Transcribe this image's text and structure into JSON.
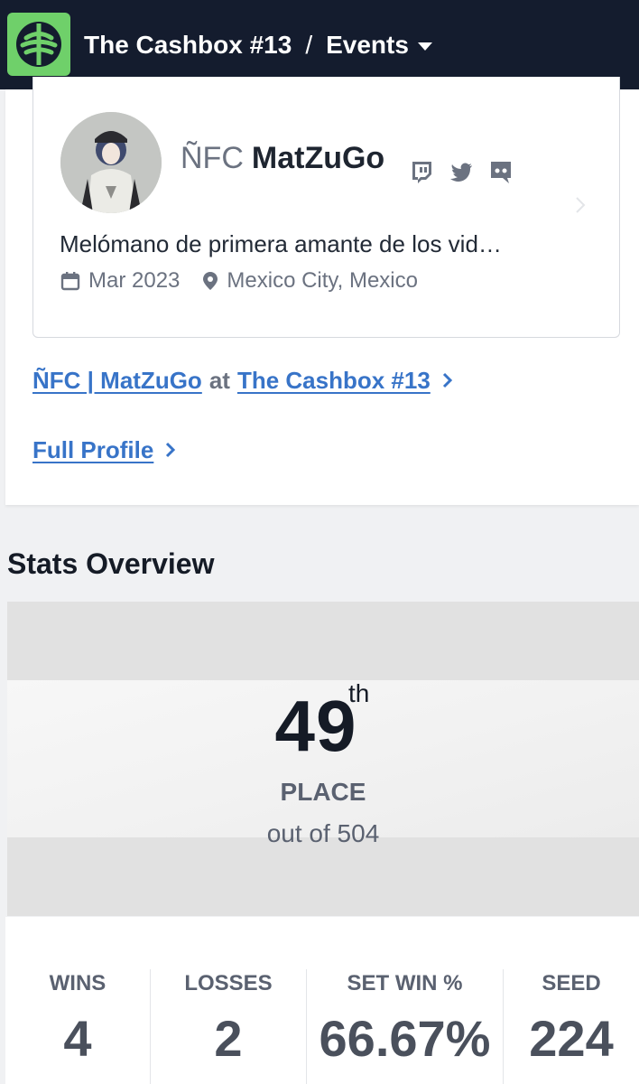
{
  "header": {
    "tournament": "The Cashbox #13",
    "separator": "/",
    "section": "Events"
  },
  "profile": {
    "prefix": "ÑFC",
    "gamer_tag": "MatZuGo",
    "bio": "Melómano de primera amante de los vid…",
    "joined": "Mar 2023",
    "location": "Mexico City, Mexico",
    "socials": [
      "twitch-icon",
      "twitter-icon",
      "discord-icon"
    ]
  },
  "links": {
    "entrant": "ÑFC | MatZuGo",
    "at": "at",
    "event": "The Cashbox #13",
    "full_profile": "Full Profile"
  },
  "stats": {
    "heading": "Stats Overview",
    "placement": "49",
    "ordinal": "th",
    "placement_label": "PLACE",
    "out_of": "out of 504",
    "items": [
      {
        "label": "WINS",
        "value": "4"
      },
      {
        "label": "LOSSES",
        "value": "2"
      },
      {
        "label": "SET WIN %",
        "value": "66.67%"
      },
      {
        "label": "SEED",
        "value": "224"
      }
    ]
  },
  "colors": {
    "topbar": "#141c2e",
    "logo": "#6fd06a",
    "link": "#3874c8"
  }
}
